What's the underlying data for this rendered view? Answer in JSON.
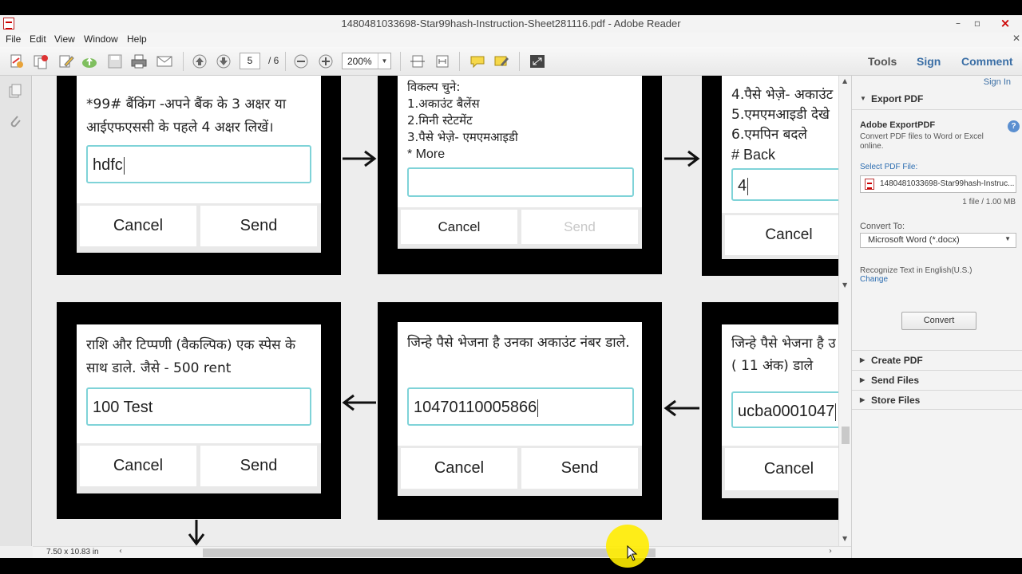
{
  "window": {
    "title": "1480481033698-Star99hash-Instruction-Sheet281116.pdf - Adobe Reader"
  },
  "menu": [
    "File",
    "Edit",
    "View",
    "Window",
    "Help"
  ],
  "toolbar": {
    "page_current": "5",
    "page_total": "/ 6",
    "zoom": "200%",
    "tabs": [
      "Tools",
      "Sign",
      "Comment"
    ]
  },
  "document": {
    "page_size": "7.50 x 10.83 in",
    "screens": [
      {
        "text": "*99# बैंकिंग -अपने बैंक के 3 अक्षर या आईएफएससी के पहले 4 अक्षर लिखें।",
        "input": "hdfc",
        "buttons": [
          "Cancel",
          "Send"
        ]
      },
      {
        "lines": [
          "विकल्प चुने:",
          "1.अकाउंट बैलेंस",
          "2.मिनी स्टेटमेंट",
          "3.पैसे भेज़े- एमएमआइडी",
          "* More"
        ],
        "input": "",
        "buttons": [
          "Cancel",
          "Send"
        ]
      },
      {
        "lines": [
          "4.पैसे भेज़े- अकाउंट",
          "5.एमएमआइडी देखे",
          "6.एमपिन बदले",
          "# Back"
        ],
        "input": "4",
        "buttons": [
          "Cancel"
        ]
      },
      {
        "text": "राशि और टिप्पणी (वैकल्पिक) एक स्पेस के साथ डाले. जैसे - 500 rent",
        "input": "100 Test",
        "buttons": [
          "Cancel",
          "Send"
        ]
      },
      {
        "text": "जिन्हे पैसे भेजना है उनका अकाउंट नंबर डाले.",
        "input": "10470110005866",
        "buttons": [
          "Cancel",
          "Send"
        ]
      },
      {
        "text": "जिन्हे पैसे भेजना है उ ( 11 अंक) डाले",
        "input": "ucba0001047",
        "buttons": [
          "Cancel"
        ]
      }
    ]
  },
  "right_pane": {
    "sign_in": "Sign In",
    "export_header": "Export PDF",
    "export_title": "Adobe ExportPDF",
    "export_desc": "Convert PDF files to Word or Excel online.",
    "select_label": "Select PDF File:",
    "file_name": "1480481033698-Star99hash-Instruc...",
    "file_info": "1 file / 1.00 MB",
    "convert_to_label": "Convert To:",
    "convert_to_value": "Microsoft Word (*.docx)",
    "recognize": "Recognize Text in English(U.S.)",
    "change": "Change",
    "convert_button": "Convert",
    "sections": [
      "Create PDF",
      "Send Files",
      "Store Files"
    ]
  }
}
